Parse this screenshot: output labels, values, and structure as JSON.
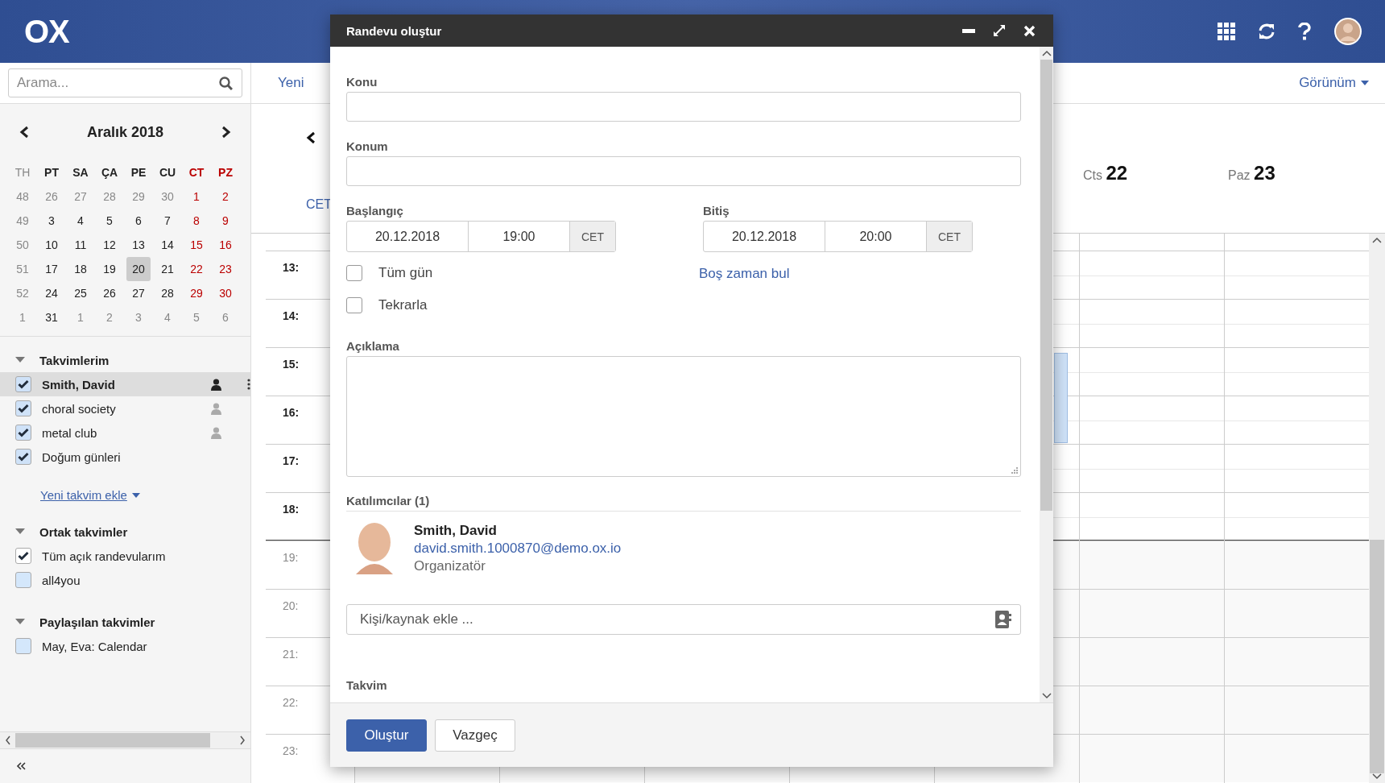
{
  "header": {
    "logo": "OX"
  },
  "search": {
    "placeholder": "Arama..."
  },
  "mini_calendar": {
    "title": "Aralık 2018",
    "weekdays": [
      {
        "label": "TH",
        "kind": "week"
      },
      {
        "label": "PT",
        "kind": "weekday"
      },
      {
        "label": "SA",
        "kind": "weekday"
      },
      {
        "label": "ÇA",
        "kind": "weekday"
      },
      {
        "label": "PE",
        "kind": "weekday"
      },
      {
        "label": "CU",
        "kind": "weekday"
      },
      {
        "label": "CT",
        "kind": "weekend"
      },
      {
        "label": "PZ",
        "kind": "weekend"
      }
    ],
    "weeks": [
      {
        "week": "48",
        "days": [
          {
            "label": "26",
            "kind": "other",
            "selected": false
          },
          {
            "label": "27",
            "kind": "other",
            "selected": false
          },
          {
            "label": "28",
            "kind": "other",
            "selected": false
          },
          {
            "label": "29",
            "kind": "other",
            "selected": false
          },
          {
            "label": "30",
            "kind": "other",
            "selected": false
          },
          {
            "label": "1",
            "kind": "weekend",
            "selected": false
          },
          {
            "label": "2",
            "kind": "weekend",
            "selected": false
          }
        ]
      },
      {
        "week": "49",
        "days": [
          {
            "label": "3",
            "kind": "weekday",
            "selected": false
          },
          {
            "label": "4",
            "kind": "weekday",
            "selected": false
          },
          {
            "label": "5",
            "kind": "weekday",
            "selected": false
          },
          {
            "label": "6",
            "kind": "weekday",
            "selected": false
          },
          {
            "label": "7",
            "kind": "weekday",
            "selected": false
          },
          {
            "label": "8",
            "kind": "weekend",
            "selected": false
          },
          {
            "label": "9",
            "kind": "weekend",
            "selected": false
          }
        ]
      },
      {
        "week": "50",
        "days": [
          {
            "label": "10",
            "kind": "weekday",
            "selected": false
          },
          {
            "label": "11",
            "kind": "weekday",
            "selected": false
          },
          {
            "label": "12",
            "kind": "weekday",
            "selected": false
          },
          {
            "label": "13",
            "kind": "weekday",
            "selected": false
          },
          {
            "label": "14",
            "kind": "weekday",
            "selected": false
          },
          {
            "label": "15",
            "kind": "weekend",
            "selected": false
          },
          {
            "label": "16",
            "kind": "weekend",
            "selected": false
          }
        ]
      },
      {
        "week": "51",
        "days": [
          {
            "label": "17",
            "kind": "weekday",
            "selected": false
          },
          {
            "label": "18",
            "kind": "weekday",
            "selected": false
          },
          {
            "label": "19",
            "kind": "weekday",
            "selected": false
          },
          {
            "label": "20",
            "kind": "weekday",
            "selected": true
          },
          {
            "label": "21",
            "kind": "weekday",
            "selected": false
          },
          {
            "label": "22",
            "kind": "weekend",
            "selected": false
          },
          {
            "label": "23",
            "kind": "weekend",
            "selected": false
          }
        ]
      },
      {
        "week": "52",
        "days": [
          {
            "label": "24",
            "kind": "weekday",
            "selected": false
          },
          {
            "label": "25",
            "kind": "weekday",
            "selected": false
          },
          {
            "label": "26",
            "kind": "weekday",
            "selected": false
          },
          {
            "label": "27",
            "kind": "weekday",
            "selected": false
          },
          {
            "label": "28",
            "kind": "weekday",
            "selected": false
          },
          {
            "label": "29",
            "kind": "weekend",
            "selected": false
          },
          {
            "label": "30",
            "kind": "weekend",
            "selected": false
          }
        ]
      },
      {
        "week": "1",
        "days": [
          {
            "label": "31",
            "kind": "weekday",
            "selected": false
          },
          {
            "label": "1",
            "kind": "other",
            "selected": false
          },
          {
            "label": "2",
            "kind": "other",
            "selected": false
          },
          {
            "label": "3",
            "kind": "other",
            "selected": false
          },
          {
            "label": "4",
            "kind": "other",
            "selected": false
          },
          {
            "label": "5",
            "kind": "other",
            "selected": false
          },
          {
            "label": "6",
            "kind": "other",
            "selected": false
          }
        ]
      }
    ]
  },
  "sidebar": {
    "sections": [
      {
        "title": "Takvimlerim",
        "expanded": true,
        "items": [
          {
            "label": "Smith, David",
            "checked": true,
            "selected": true,
            "color": "#cfe2f8",
            "owner_icon": true
          },
          {
            "label": "choral society",
            "checked": true,
            "selected": false,
            "color": "#cfe2f8",
            "owner_icon": true
          },
          {
            "label": "metal club",
            "checked": true,
            "selected": false,
            "color": "#cfe2f8",
            "owner_icon": true
          },
          {
            "label": "Doğum günleri",
            "checked": true,
            "selected": false,
            "color": "#cfe2f8",
            "owner_icon": false
          }
        ],
        "add_link": "Yeni takvim ekle"
      },
      {
        "title": "Ortak takvimler",
        "expanded": true,
        "items": [
          {
            "label": "Tüm açık randevularım",
            "checked": true,
            "selected": false,
            "color": "#ffffff",
            "owner_icon": false
          },
          {
            "label": "all4you",
            "checked": false,
            "selected": false,
            "color": "#d4e7fb",
            "owner_icon": false
          }
        ]
      },
      {
        "title": "Paylaşılan takvimler",
        "expanded": true,
        "items": [
          {
            "label": "May, Eva: Calendar",
            "checked": false,
            "selected": false,
            "color": "#d4e7fb",
            "owner_icon": false
          }
        ]
      }
    ]
  },
  "toolbar": {
    "new": "Yeni",
    "view": "Görünüm"
  },
  "week_view": {
    "timezone": "CET",
    "days": [
      {
        "weekday": "Cts",
        "day": "22"
      },
      {
        "weekday": "Paz",
        "day": "23"
      }
    ],
    "hours": [
      {
        "label": "13:",
        "kind": "work"
      },
      {
        "label": "14:",
        "kind": "work"
      },
      {
        "label": "15:",
        "kind": "work"
      },
      {
        "label": "16:",
        "kind": "work"
      },
      {
        "label": "17:",
        "kind": "work"
      },
      {
        "label": "18:",
        "kind": "work"
      },
      {
        "label": "19:",
        "kind": "off"
      },
      {
        "label": "20:",
        "kind": "off"
      },
      {
        "label": "21:",
        "kind": "off"
      },
      {
        "label": "22:",
        "kind": "off"
      },
      {
        "label": "23:",
        "kind": "off"
      }
    ]
  },
  "dialog": {
    "title": "Randevu oluştur",
    "subject_label": "Konu",
    "location_label": "Konum",
    "start": {
      "label": "Başlangıç",
      "date": "20.12.2018",
      "time": "19:00",
      "tz": "CET"
    },
    "end": {
      "label": "Bitiş",
      "date": "20.12.2018",
      "time": "20:00",
      "tz": "CET"
    },
    "options": [
      {
        "label": "Tüm gün",
        "checked": false
      },
      {
        "label": "Tekrarla",
        "checked": false
      }
    ],
    "find_free_time": "Boş zaman bul",
    "description_label": "Açıklama",
    "participants_title": "Katılımcılar (1)",
    "participants": [
      {
        "name": "Smith, David",
        "email": "david.smith.1000870@demo.ox.io",
        "role": "Organizatör"
      }
    ],
    "add_participant": {
      "placeholder": "Kişi/kaynak ekle ..."
    },
    "calendar_label": "Takvim",
    "buttons": [
      {
        "label": "Oluştur",
        "kind": "primary"
      },
      {
        "label": "Vazgeç",
        "kind": "default"
      }
    ]
  }
}
